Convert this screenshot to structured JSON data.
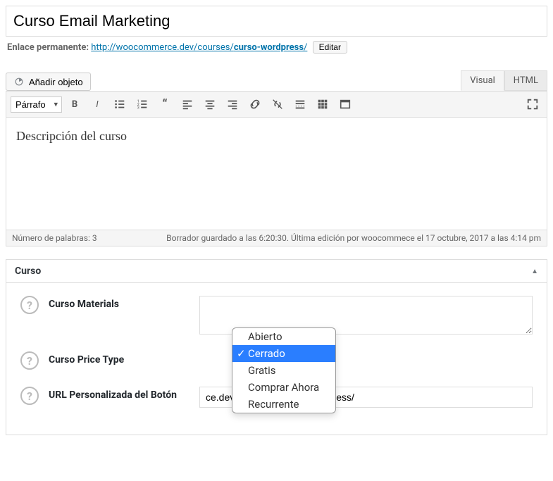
{
  "title": "Curso Email Marketing",
  "permalink": {
    "label": "Enlace permanente:",
    "base": "http://woocommerce.dev/courses/",
    "slug": "curso-wordpress",
    "edit_label": "Editar"
  },
  "media_button": "Añadir objeto",
  "tabs": {
    "visual": "Visual",
    "html": "HTML"
  },
  "format_selector": "Párrafo",
  "editor_content": "Descripción del curso",
  "word_count_label": "Número de palabras: 3",
  "save_status": "Borrador guardado a las 6:20:30. Última edición por woocommece el 17 octubre, 2017 a las 4:14 pm",
  "metabox": {
    "title": "Curso",
    "fields": {
      "materials_label": "Curso Materials",
      "materials_value": "",
      "price_type_label": "Curso Price Type",
      "price_type_options": [
        "Abierto",
        "Cerrado",
        "Gratis",
        "Comprar Ahora",
        "Recurrente"
      ],
      "price_type_selected": "Cerrado",
      "url_label": "URL Personalizada del Botón",
      "url_value": "ce.dev/producto/curso-wordpress/"
    }
  }
}
